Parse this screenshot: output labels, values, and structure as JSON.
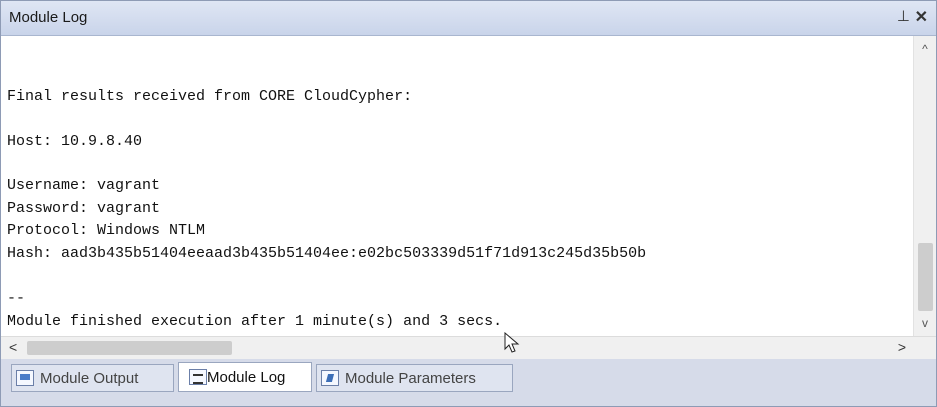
{
  "window": {
    "title": "Module Log",
    "pin_glyph": "⊥",
    "close_glyph": "✕"
  },
  "log": {
    "lines": [
      "",
      "Final results received from CORE CloudCypher:",
      "",
      "Host: 10.9.8.40",
      "",
      "Username: vagrant",
      "Password: vagrant",
      "Protocol: Windows NTLM",
      "Hash: aad3b435b51404eeaad3b435b51404ee:e02bc503339d51f71d913c245d35b50b",
      "",
      "--",
      "Module finished execution after 1 minute(s) and 3 secs."
    ]
  },
  "scroll": {
    "up_glyph": "^",
    "down_glyph": "v",
    "left_glyph": "<",
    "right_glyph": ">"
  },
  "tabs": [
    {
      "label": "Module Output",
      "icon": "monitor-icon",
      "active": false
    },
    {
      "label": "Module Log",
      "icon": "log-icon",
      "active": true
    },
    {
      "label": "Module Parameters",
      "icon": "parameters-icon",
      "active": false
    }
  ]
}
